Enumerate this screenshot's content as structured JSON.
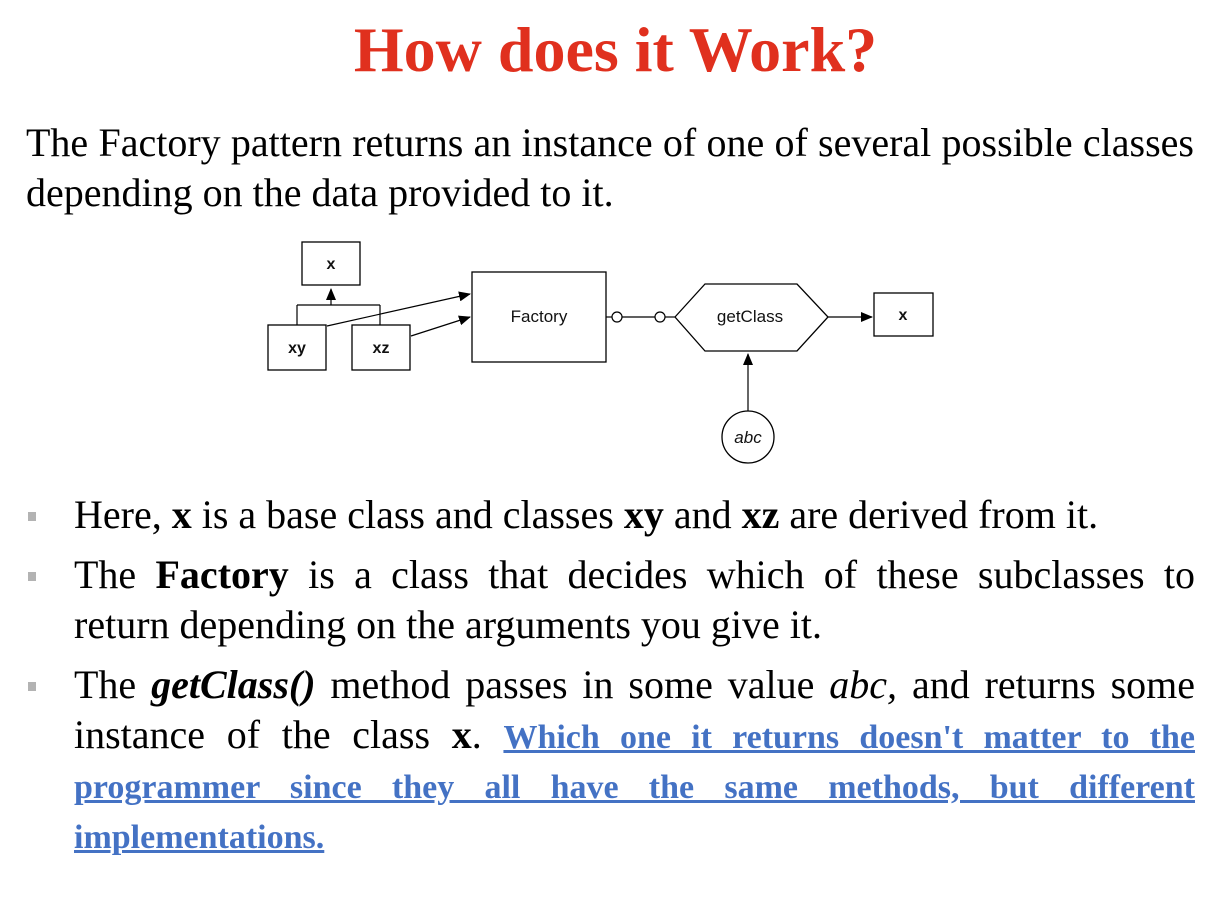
{
  "title": "How does it Work?",
  "intro": "The Factory pattern returns an instance of one of several possible classes depending on the data provided to it.",
  "diagram": {
    "nodes": {
      "base_class": "x",
      "derived_xy": "xy",
      "derived_xz": "xz",
      "factory": "Factory",
      "method": "getClass",
      "result_class": "x",
      "input_value": "abc"
    }
  },
  "bullets": [
    {
      "p1": "Here, ",
      "b1": "x",
      "p2": " is a base class and classes ",
      "b2": "xy",
      "p3": " and ",
      "b3": "xz",
      "p4": " are derived from it."
    },
    {
      "p1": "The ",
      "b1": "Factory",
      "p2": " is a class that decides which of these subclasses to return depending on the arguments you give it."
    },
    {
      "p1": "The ",
      "bi1": "getClass()",
      "p2": " method passes in some value ",
      "i1": "abc,",
      "p3": " and returns some instance of the class ",
      "b1": "x",
      "p4": ". ",
      "link": "Which one it returns doesn't matter to the programmer since they all have the same methods, but different implementations."
    }
  ],
  "colors": {
    "title": "#e0301e",
    "link": "#4472c4",
    "bullet_marker": "#b3b3b3"
  }
}
